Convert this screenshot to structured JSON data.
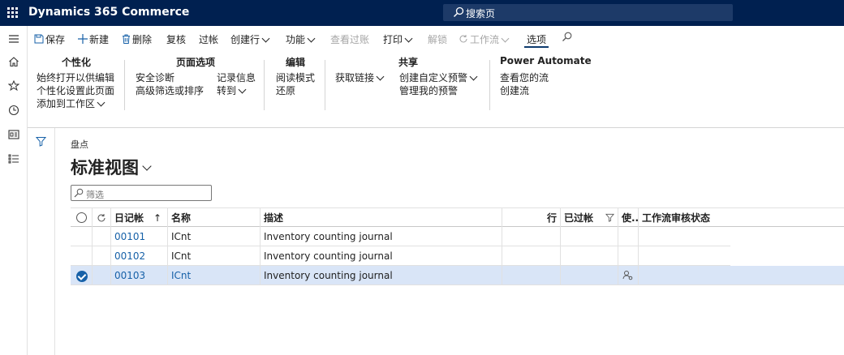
{
  "app": {
    "title": "Dynamics 365 Commerce",
    "search_label": "搜索页"
  },
  "actions": [
    {
      "key": "save",
      "label": "保存",
      "icon": "save-icon",
      "disabled": false
    },
    {
      "key": "new",
      "label": "新建",
      "icon": "plus-icon",
      "disabled": false
    },
    {
      "key": "delete",
      "label": "删除",
      "icon": "trash-icon",
      "disabled": false
    },
    {
      "key": "review",
      "label": "复核",
      "disabled": false
    },
    {
      "key": "post",
      "label": "过帐",
      "disabled": false
    },
    {
      "key": "create_line",
      "label": "创建行",
      "dropdown": true,
      "disabled": false
    },
    {
      "key": "functions",
      "label": "功能",
      "dropdown": true,
      "disabled": false
    },
    {
      "key": "view_posting",
      "label": "查看过账",
      "disabled": true
    },
    {
      "key": "print",
      "label": "打印",
      "dropdown": true,
      "disabled": false
    },
    {
      "key": "unlock",
      "label": "解锁",
      "disabled": true
    },
    {
      "key": "workflow",
      "label": "工作流",
      "dropdown": true,
      "disabled": true
    },
    {
      "key": "options",
      "label": "选项",
      "selected": true,
      "disabled": false
    }
  ],
  "ribbon": {
    "personalize": {
      "title": "个性化",
      "items": [
        "始终打开以供编辑",
        "个性化设置此页面",
        "添加到工作区"
      ]
    },
    "page_options": {
      "title": "页面选项",
      "items": [
        "安全诊断",
        "高级筛选或排序",
        "记录信息",
        "转到"
      ]
    },
    "edit": {
      "title": "编辑",
      "items": [
        "阅读模式",
        "还原"
      ]
    },
    "share": {
      "title": "共享",
      "items": [
        "获取链接",
        "创建自定义预警",
        "管理我的预警"
      ]
    },
    "power_automate": {
      "title": "Power Automate",
      "items": [
        "查看您的流",
        "创建流"
      ]
    }
  },
  "page": {
    "breadcrumb": "盘点",
    "view_title": "标准视图",
    "filter_placeholder": "筛选"
  },
  "grid": {
    "columns": [
      "日记帐",
      "名称",
      "描述",
      "行",
      "已过帐",
      "使..",
      "工作流审核状态"
    ],
    "rows": [
      {
        "journal": "00101",
        "name": "ICnt",
        "description": "Inventory counting journal",
        "selected": false
      },
      {
        "journal": "00102",
        "name": "ICnt",
        "description": "Inventory counting journal",
        "selected": false
      },
      {
        "journal": "00103",
        "name": "ICnt",
        "description": "Inventory counting journal",
        "selected": true
      }
    ]
  },
  "colors": {
    "topbar": "#002050",
    "link": "#1761a8",
    "selected_row": "#d9e5f7"
  }
}
